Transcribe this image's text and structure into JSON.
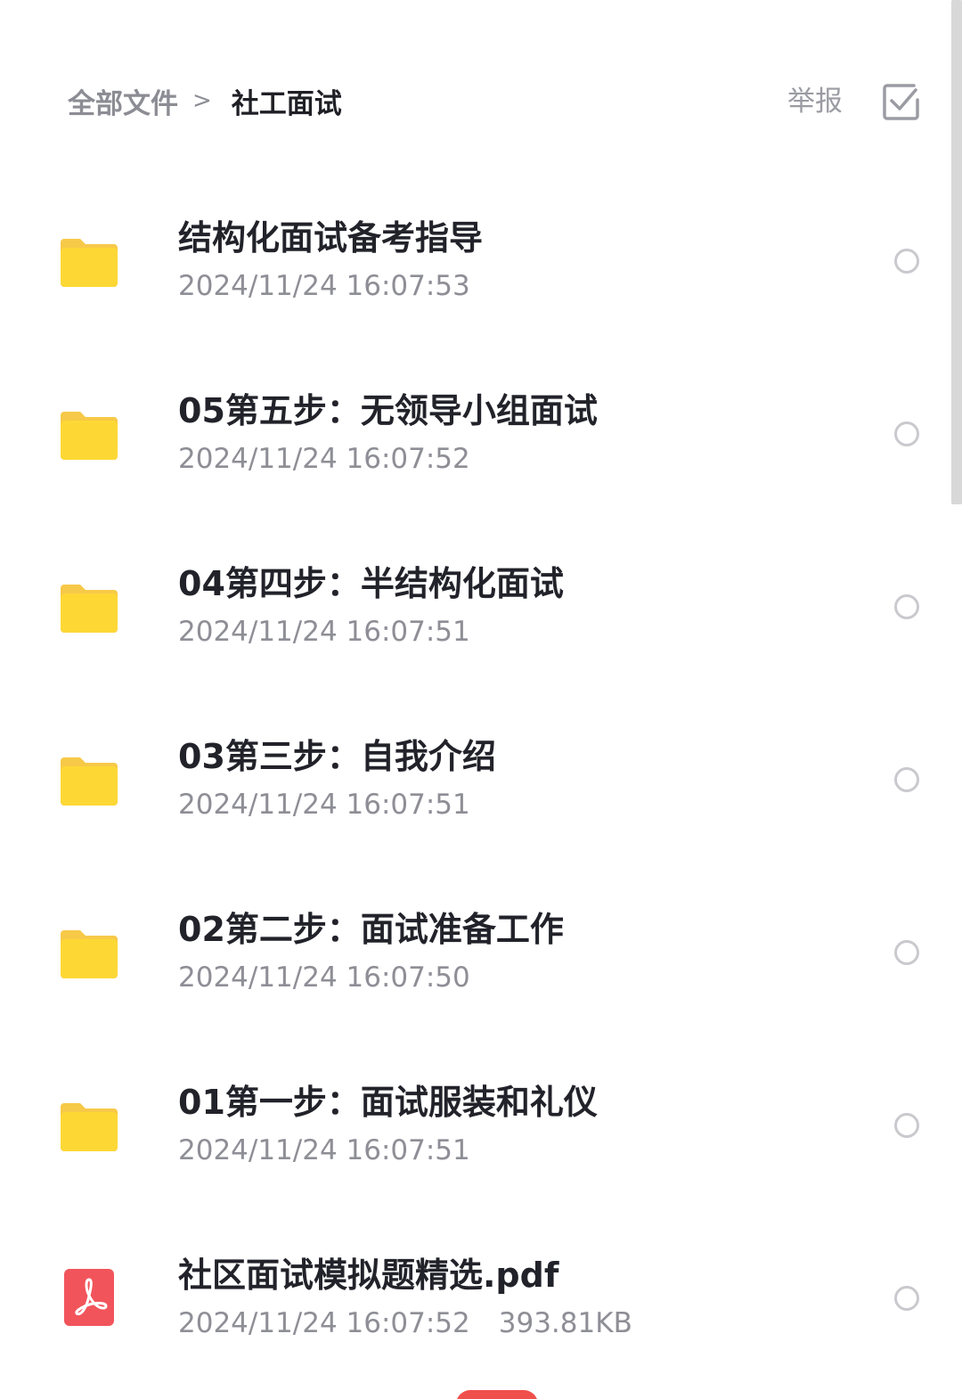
{
  "header": {
    "breadcrumb_root": "全部文件",
    "breadcrumb_separator": ">",
    "breadcrumb_current": "社工面试",
    "report_label": "举报",
    "select_icon": "checkbox-check-icon"
  },
  "files": [
    {
      "name": "结构化面试备考指导",
      "date": "2024/11/24 16:07:53",
      "type": "folder",
      "icon": "folder-icon"
    },
    {
      "name": "05第五步：无领导小组面试",
      "date": "2024/11/24 16:07:52",
      "type": "folder",
      "icon": "folder-icon"
    },
    {
      "name": "04第四步：半结构化面试",
      "date": "2024/11/24 16:07:51",
      "type": "folder",
      "icon": "folder-icon"
    },
    {
      "name": "03第三步：自我介绍",
      "date": "2024/11/24 16:07:51",
      "type": "folder",
      "icon": "folder-icon"
    },
    {
      "name": "02第二步：面试准备工作",
      "date": "2024/11/24 16:07:50",
      "type": "folder",
      "icon": "folder-icon"
    },
    {
      "name": "01第一步：面试服装和礼仪",
      "date": "2024/11/24 16:07:51",
      "type": "folder",
      "icon": "folder-icon"
    },
    {
      "name": "社区面试模拟题精选.pdf",
      "date": "2024/11/24 16:07:52",
      "size": "393.81KB",
      "type": "pdf",
      "icon": "pdf-icon"
    }
  ],
  "colors": {
    "folder": "#FDD835",
    "folder_dark": "#F7C948",
    "pdf": "#F2545B",
    "accent": "#F0504C"
  }
}
